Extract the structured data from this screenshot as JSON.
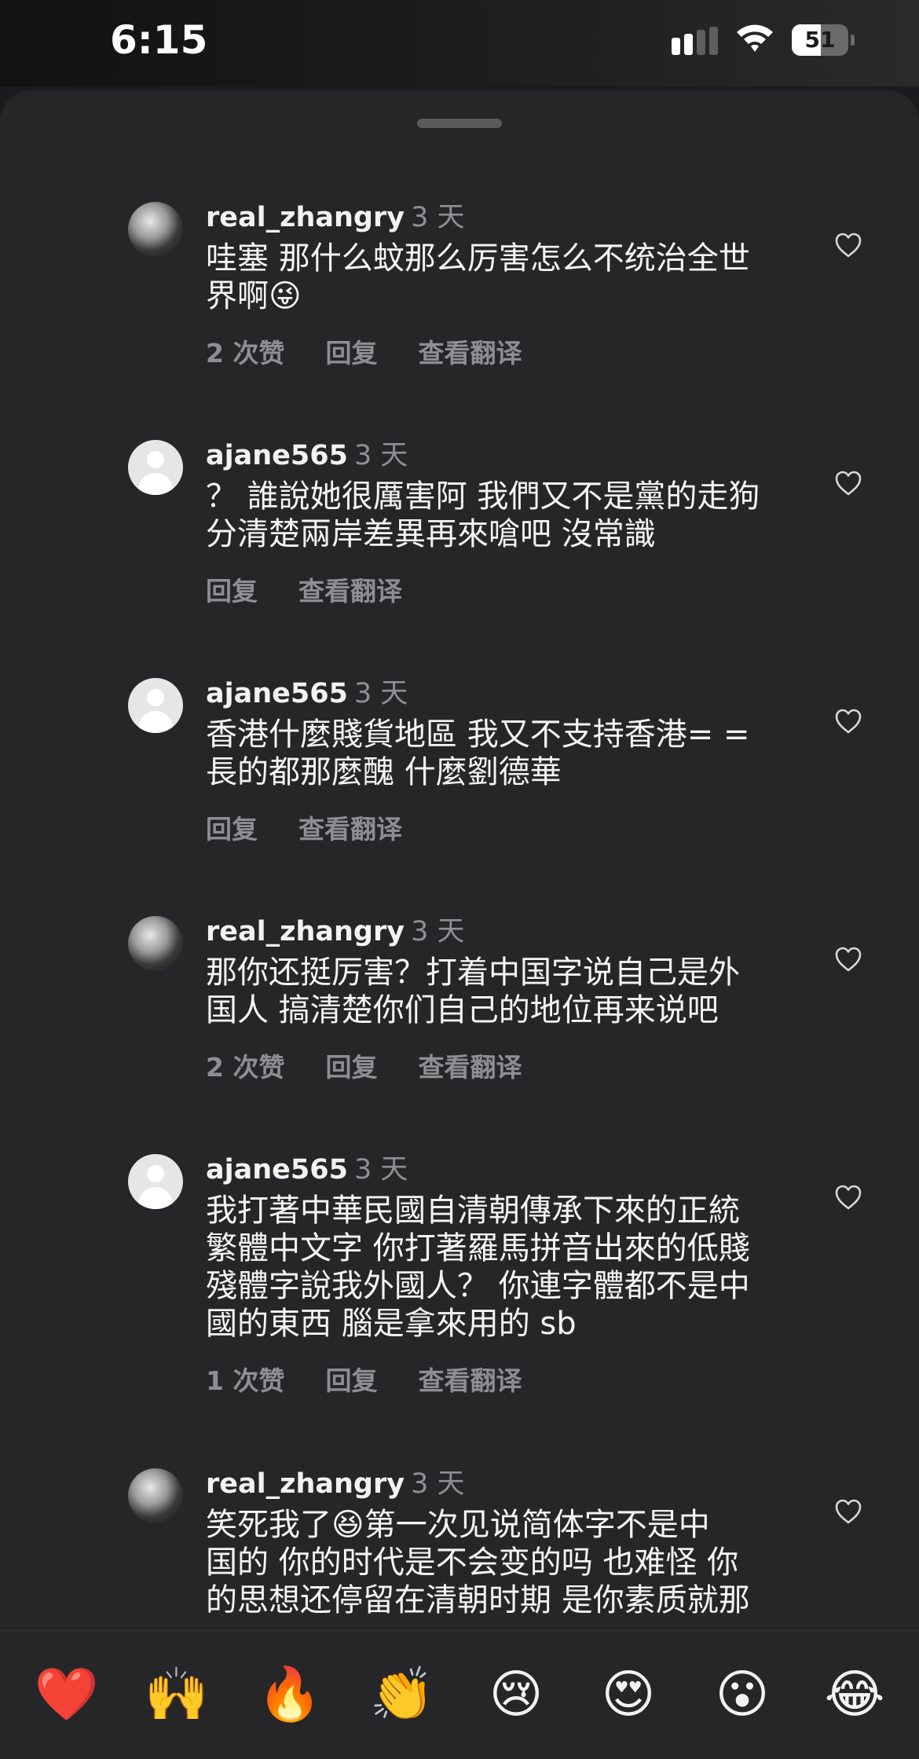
{
  "status_bar": {
    "time": "6:15",
    "battery_level": "51",
    "battery_fraction": 0.51
  },
  "comments": [
    {
      "username": "real_zhangry",
      "time_ago": "3 天",
      "avatar": "photo",
      "lines": [
        "哇塞 那什么蚊那么厉害怎么不统治全世",
        "界啊😜"
      ],
      "likes": "2 次赞",
      "reply": "回复",
      "translate": "查看翻译"
    },
    {
      "username": "ajane565",
      "time_ago": "3 天",
      "avatar": "default",
      "lines": [
        "？ 誰說她很厲害阿 我們又不是黨的走狗",
        "分清楚兩岸差異再來嗆吧 沒常識"
      ],
      "likes": "",
      "reply": "回复",
      "translate": "查看翻译"
    },
    {
      "username": "ajane565",
      "time_ago": "3 天",
      "avatar": "default",
      "lines": [
        "香港什麼賤貨地區 我又不支持香港= =",
        "長的都那麼醜 什麼劉德華"
      ],
      "likes": "",
      "reply": "回复",
      "translate": "查看翻译"
    },
    {
      "username": "real_zhangry",
      "time_ago": "3 天",
      "avatar": "photo",
      "lines": [
        "那你还挺厉害？打着中国字说自己是外",
        "国人 搞清楚你们自己的地位再来说吧"
      ],
      "likes": "2 次赞",
      "reply": "回复",
      "translate": "查看翻译"
    },
    {
      "username": "ajane565",
      "time_ago": "3 天",
      "avatar": "default",
      "lines": [
        "我打著中華民國自清朝傳承下來的正統",
        "繁體中文字 你打著羅馬拼音出來的低賤",
        "殘體字說我外國人？ 你連字體都不是中",
        "國的東西 腦是拿來用的 sb"
      ],
      "likes": "1 次赞",
      "reply": "回复",
      "translate": "查看翻译"
    },
    {
      "username": "real_zhangry",
      "time_ago": "3 天",
      "avatar": "photo",
      "lines": [
        "笑死我了😆第一次见说简体字不是中",
        "国的 你的时代是不会变的吗 也难怪 你",
        "的思想还停留在清朝时期 是你素质就那"
      ],
      "likes": "",
      "reply": "",
      "translate": ""
    }
  ],
  "reactions": [
    "❤️",
    "🙌",
    "🔥",
    "👏",
    "😢",
    "😍",
    "😮",
    "😂"
  ],
  "icons": {
    "heart": "heart-outline-icon",
    "signal": "cellular-signal-icon",
    "wifi": "wifi-icon",
    "battery": "battery-icon"
  }
}
